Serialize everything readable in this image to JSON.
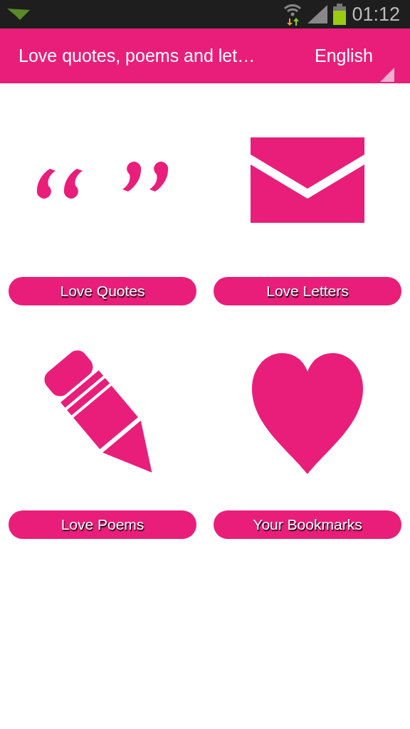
{
  "status_bar": {
    "time": "01:12"
  },
  "header": {
    "title": "Love quotes, poems and let…",
    "language": "English"
  },
  "tiles": [
    {
      "kind": "quotes",
      "label": "Love Quotes"
    },
    {
      "kind": "letters",
      "label": "Love Letters"
    },
    {
      "kind": "poems",
      "label": "Love Poems"
    },
    {
      "kind": "bookmarks",
      "label": "Your Bookmarks"
    }
  ]
}
